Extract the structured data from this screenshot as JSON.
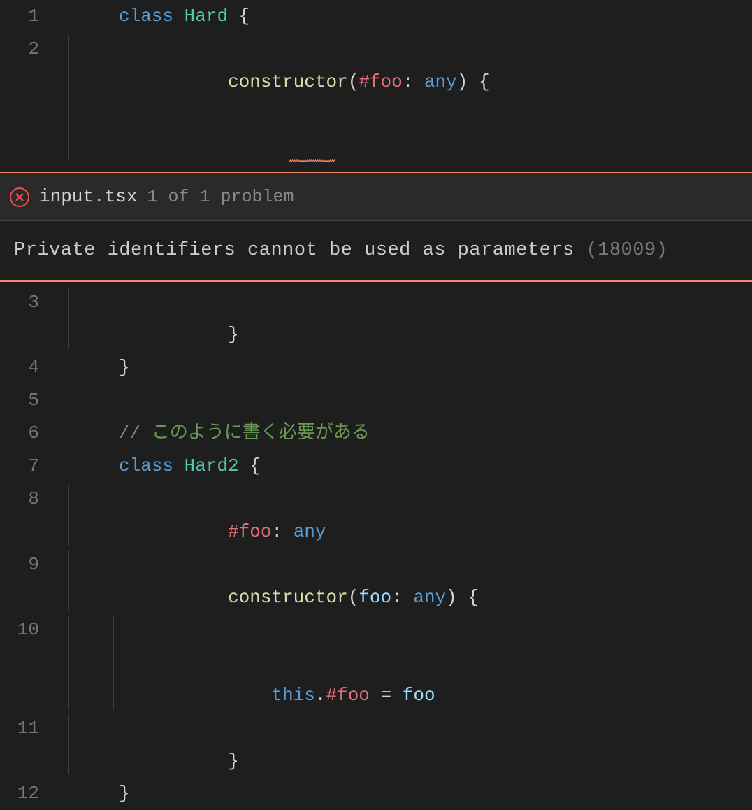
{
  "lineNumbers": [
    "1",
    "2",
    "3",
    "4",
    "5",
    "6",
    "7",
    "8",
    "9",
    "10",
    "11",
    "12"
  ],
  "tokens": {
    "class": "class",
    "hard": "Hard",
    "hard2": "Hard2",
    "constructor": "constructor",
    "hashFoo": "#foo",
    "foo": "foo",
    "any": "any",
    "this": "this",
    "openBrace": "{",
    "closeBrace": "}",
    "openParen": "(",
    "closeParen": ")",
    "colon": ":",
    "dot": ".",
    "equals": "=",
    "comment": "// このように書く必要がある"
  },
  "error": {
    "filename": "input.tsx",
    "count": "1 of 1 problem",
    "message": "Private identifiers cannot be used as parameters",
    "code": "(18009)"
  }
}
